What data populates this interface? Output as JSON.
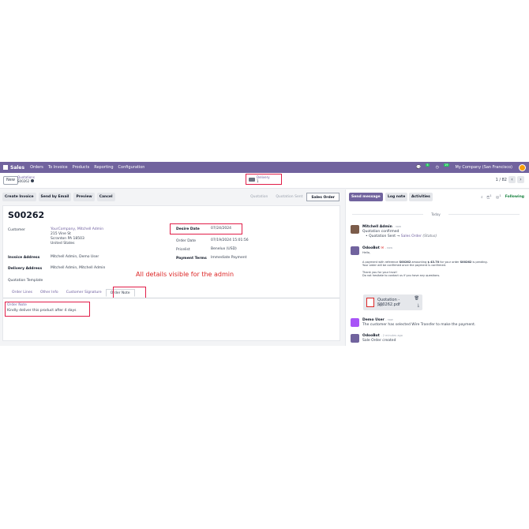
{
  "navbar": {
    "app": "Sales",
    "menu": [
      "Orders",
      "To Invoice",
      "Products",
      "Reporting",
      "Configuration"
    ],
    "chat_count": "5",
    "activity_count": "19",
    "company": "My Company (San Francisco)"
  },
  "control": {
    "new_label": "New",
    "breadcrumb_parent": "Quotations",
    "breadcrumb_current": "S00262",
    "delivery_label": "Delivery",
    "delivery_count": "1",
    "pager": "1 / 82"
  },
  "actions": [
    "Create Invoice",
    "Send by Email",
    "Preview",
    "Cancel"
  ],
  "stages": [
    "Quotation",
    "Quotation Sent",
    "Sales Order"
  ],
  "form": {
    "name": "S00262",
    "customer_label": "Customer",
    "customer_name": "YourCompany, Mitchell Admin",
    "customer_street": "215 Vine St",
    "customer_city": "Scranton PA 18503",
    "customer_country": "United States",
    "invoice_address_label": "Invoice Address",
    "invoice_address": "Mitchell Admin, Demo User",
    "delivery_address_label": "Delivery Address",
    "delivery_address": "Mitchell Admin, Mitchell Admin",
    "quotation_template_label": "Quotation Template",
    "desire_date_label": "Desire Date",
    "desire_date": "07/24/2024",
    "order_date_label": "Order Date",
    "order_date": "07/19/2024 15:01:56",
    "pricelist_label": "Pricelist",
    "pricelist": "Benelux (USD)",
    "payment_terms_label": "Payment Terms",
    "payment_terms": "Immediate Payment",
    "annotation": "All details visible for the admin",
    "tabs": [
      "Order Lines",
      "Other Info",
      "Customer Signature",
      "Order Note"
    ],
    "order_note_label": "Order Note",
    "order_note": "Kindly deliver this product after 4 days"
  },
  "chatter": {
    "send_message": "Send message",
    "log_note": "Log note",
    "activities": "Activities",
    "followers_count": "1",
    "attachments_count": "1",
    "following": "Following",
    "today": "Today",
    "messages": [
      {
        "author": "Mitchell Admin",
        "time": "- now",
        "text": "Quotation confirmed",
        "change": "Quotation Sent",
        "arrow": "→",
        "change_to": "Sales Order",
        "field": "(Status)"
      },
      {
        "author": "OdooBot",
        "time": "- now",
        "hello": "Hello,",
        "p1a": "A payment with reference ",
        "p1ref": "S00262",
        "p1b": " amounting ",
        "p1amt": "$ 43.70",
        "p1c": " for your order ",
        "p1ord": "S00262",
        "p1d": " is pending.",
        "p2": "Your order will be confirmed once the payment is confirmed.",
        "p3": "Thank you for your trust!",
        "p4": "Do not hesitate to contact us if you have any questions.",
        "attachment": "Quotation - S00262.pdf",
        "attachment_type": "PDF"
      },
      {
        "author": "Demo User",
        "time": "- now",
        "text": "The customer has selected Wire Transfer to make the payment."
      },
      {
        "author": "OdooBot",
        "time": "- 2 minutes ago",
        "text": "Sale Order created"
      }
    ]
  }
}
